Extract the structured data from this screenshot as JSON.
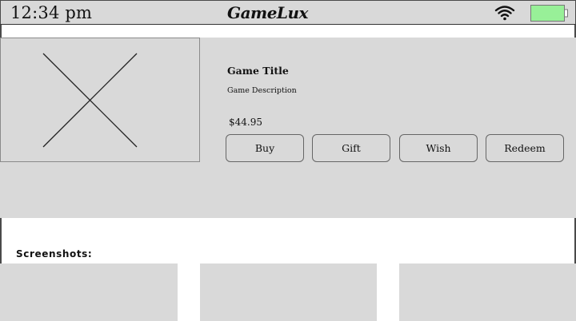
{
  "status_bar": {
    "time": "12:34 pm",
    "app_name": "GameLux",
    "wifi_icon": "wifi-icon",
    "battery_icon": "battery-icon",
    "battery_color": "#98f098"
  },
  "game": {
    "image_icon": "image-placeholder-icon",
    "title": "Game Title",
    "description": "Game Description",
    "price": "$44.95"
  },
  "actions": {
    "buy": "Buy",
    "gift": "Gift",
    "wish": "Wish",
    "redeem": "Redeem"
  },
  "screenshots": {
    "label": "Screenshots:"
  },
  "colors": {
    "panel": "#d9d9d9",
    "background": "#ffffff",
    "border": "#4a4a4a"
  }
}
